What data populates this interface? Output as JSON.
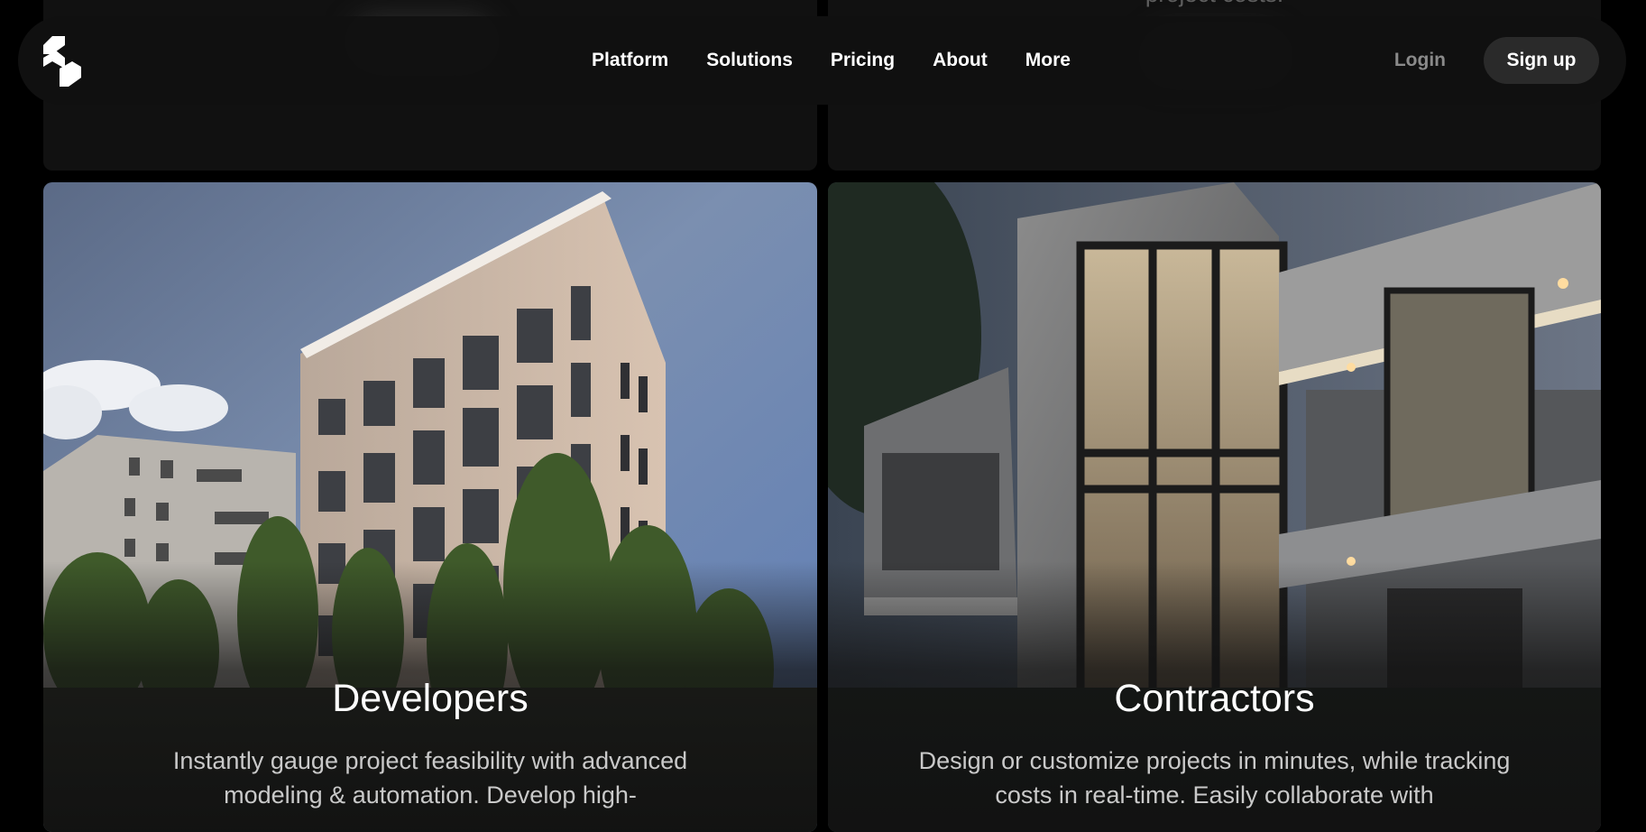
{
  "nav": {
    "links": [
      {
        "label": "Platform"
      },
      {
        "label": "Solutions"
      },
      {
        "label": "Pricing"
      },
      {
        "label": "About"
      },
      {
        "label": "More"
      }
    ],
    "login_label": "Login",
    "signup_label": "Sign up"
  },
  "top_cards": {
    "right_caption": "project costs."
  },
  "cards": [
    {
      "title": "Developers",
      "description": "Instantly gauge project feasibility with advanced modeling & automation. Develop high-"
    },
    {
      "title": "Contractors",
      "description": "Design or customize projects in minutes, while tracking costs in real-time. Easily collaborate with"
    }
  ],
  "colors": {
    "background": "#000000",
    "card": "#111111",
    "navbar": "#111111",
    "signup_button": "#2a2a2a",
    "login_text": "#8a8a8a"
  }
}
